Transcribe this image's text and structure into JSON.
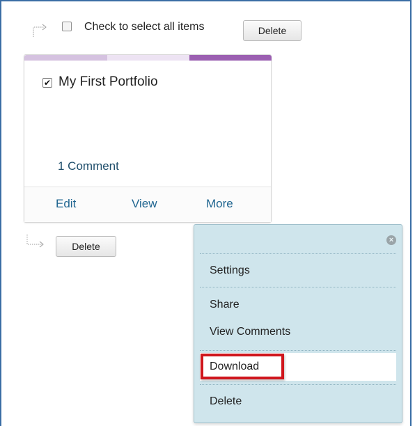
{
  "toolbar_top": {
    "select_all_label": "Check to select all items",
    "delete_label": "Delete"
  },
  "portfolio_card": {
    "title": "My First Portfolio",
    "checked": true,
    "comments": "1 Comment",
    "actions": {
      "edit": "Edit",
      "view": "View",
      "more": "More"
    },
    "accent_colors": [
      "#d5c2e0",
      "#ede3f3",
      "#9b5fb1"
    ]
  },
  "toolbar_bottom": {
    "delete_label": "Delete"
  },
  "more_menu": {
    "close_icon": "close-circle-icon",
    "items": [
      "Settings",
      "Share",
      "View Comments",
      "Download",
      "Delete"
    ],
    "highlighted": "Download",
    "highlight_color": "#d0161d",
    "background_color": "#cfe5ec"
  }
}
